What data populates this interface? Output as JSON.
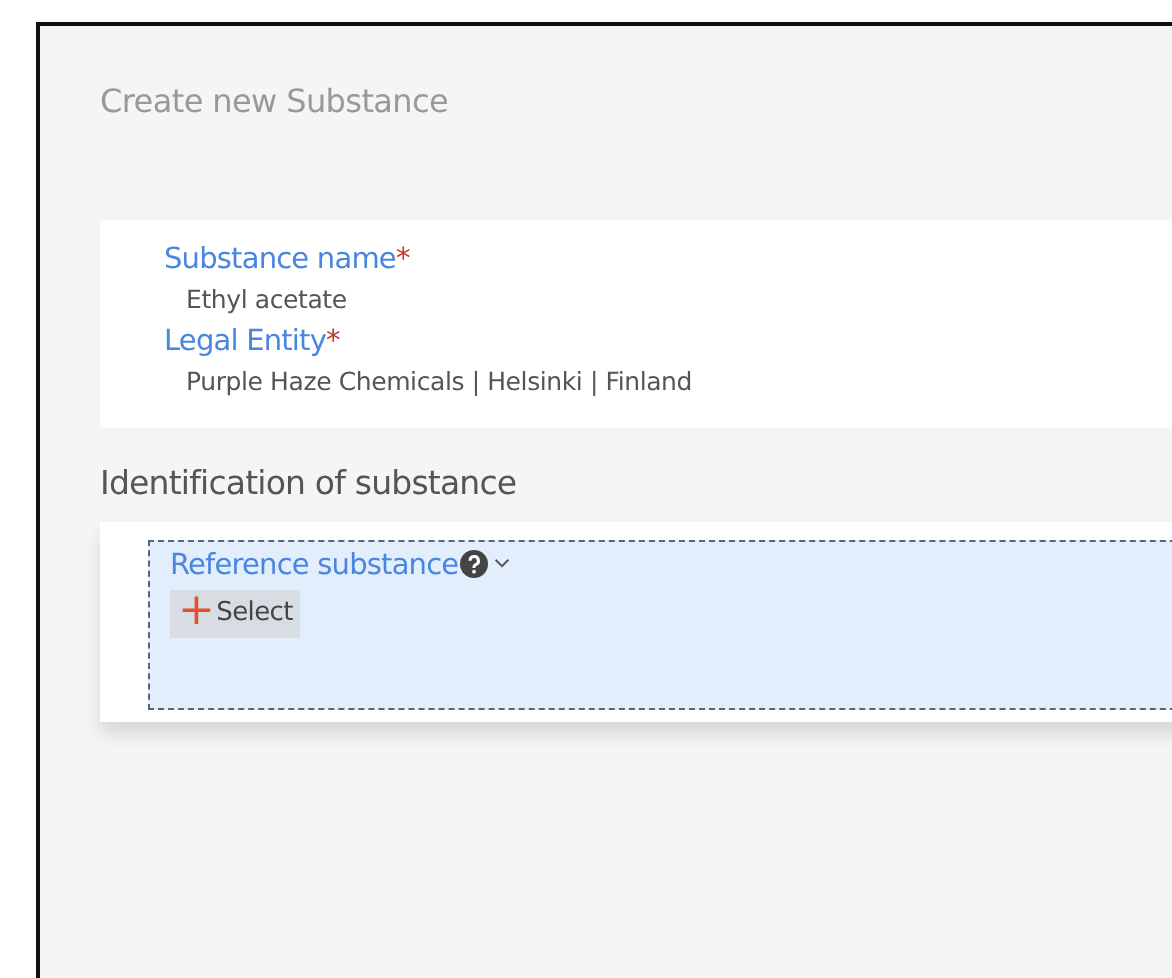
{
  "dialog": {
    "title": "Create new Substance"
  },
  "fields": [
    {
      "label": "Substance name",
      "required_mark": "*",
      "value": "Ethyl acetate"
    },
    {
      "label": "Legal Entity",
      "required_mark": "*",
      "value": "Purple Haze Chemicals | Helsinki | Finland"
    }
  ],
  "section": {
    "heading": "Identification of substance",
    "reference": {
      "label": "Reference substance",
      "button": "+",
      "button_label": "Select"
    }
  }
}
